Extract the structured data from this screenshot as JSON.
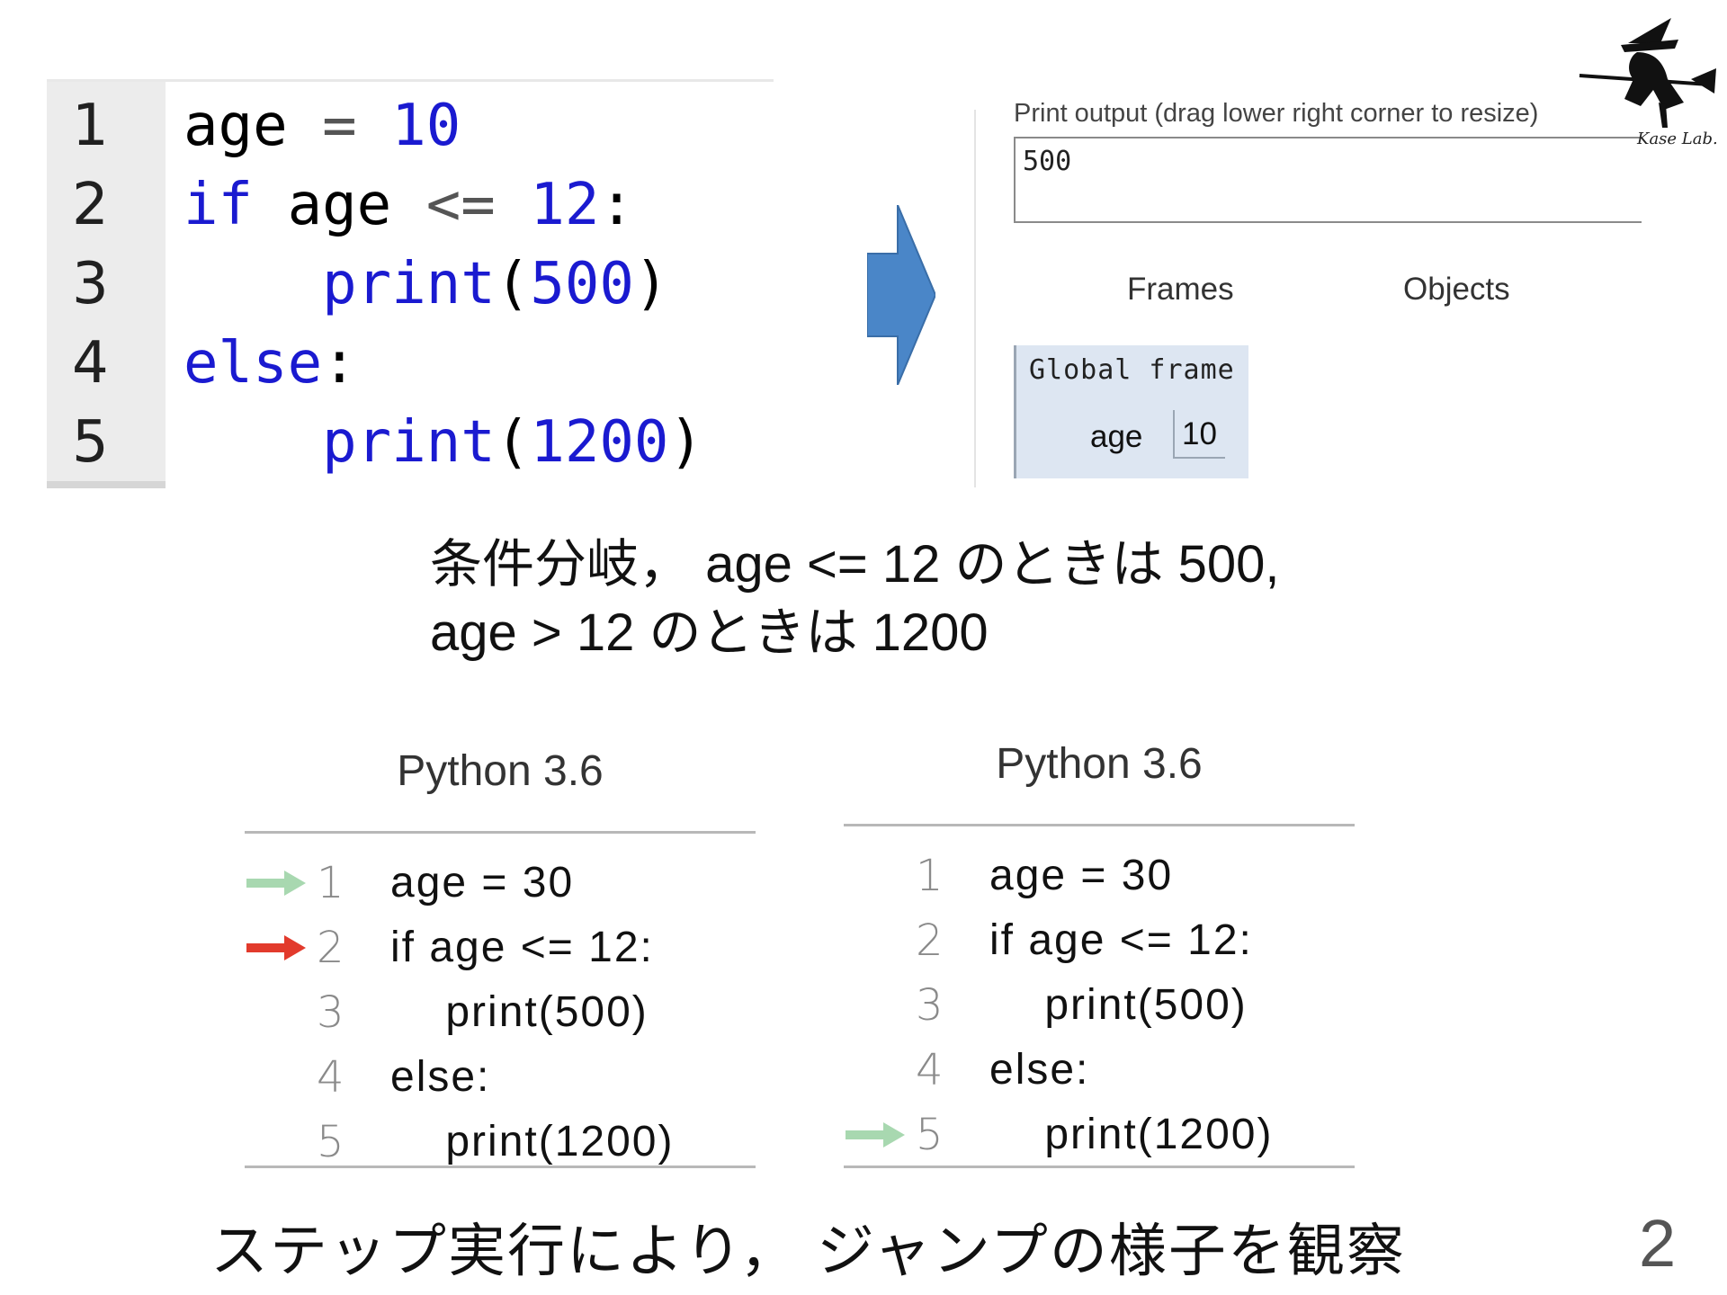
{
  "editor": {
    "lines": [
      {
        "num": "1",
        "tokens": [
          [
            "var",
            "age"
          ],
          [
            "op",
            " = "
          ],
          [
            "num",
            "10"
          ]
        ]
      },
      {
        "num": "2",
        "tokens": [
          [
            "kw",
            "if "
          ],
          [
            "var",
            "age "
          ],
          [
            "op",
            "<= "
          ],
          [
            "num",
            "12"
          ],
          [
            "var",
            ":"
          ]
        ]
      },
      {
        "num": "3",
        "tokens": [
          [
            "var",
            "    "
          ],
          [
            "kw",
            "print"
          ],
          [
            "var",
            "("
          ],
          [
            "num",
            "500"
          ],
          [
            "var",
            ")"
          ]
        ]
      },
      {
        "num": "4",
        "tokens": [
          [
            "kw",
            "else"
          ],
          [
            "var",
            ":"
          ]
        ]
      },
      {
        "num": "5",
        "tokens": [
          [
            "var",
            "    "
          ],
          [
            "kw",
            "print"
          ],
          [
            "var",
            "("
          ],
          [
            "num",
            "1200"
          ],
          [
            "var",
            ")"
          ]
        ]
      }
    ]
  },
  "arrow": {
    "icon": "right-arrow-icon",
    "color": "#4a86c8"
  },
  "output": {
    "label": "Print output (drag lower right corner to resize)",
    "value": "500"
  },
  "visualizer": {
    "frames_label": "Frames",
    "objects_label": "Objects",
    "global_frame_title": "Global frame",
    "var_name": "age",
    "var_value": "10"
  },
  "logo": {
    "text": "Kase Lab.",
    "icon": "witch-logo-icon"
  },
  "caption": {
    "line1": "条件分岐，  age <= 12 のときは 500,",
    "line2": "age > 12 のときは 1200"
  },
  "tutor_left": {
    "title": "Python 3.6",
    "lines": [
      {
        "num": "1",
        "code": "age = 30",
        "arrow": "prev"
      },
      {
        "num": "2",
        "code": "if age <= 12:",
        "arrow": "next"
      },
      {
        "num": "3",
        "code": "    print(500)",
        "arrow": ""
      },
      {
        "num": "4",
        "code": "else:",
        "arrow": ""
      },
      {
        "num": "5",
        "code": "    print(1200)",
        "arrow": ""
      }
    ]
  },
  "tutor_right": {
    "title": "Python 3.6",
    "lines": [
      {
        "num": "1",
        "code": "age = 30",
        "arrow": ""
      },
      {
        "num": "2",
        "code": "if age <= 12:",
        "arrow": ""
      },
      {
        "num": "3",
        "code": "    print(500)",
        "arrow": ""
      },
      {
        "num": "4",
        "code": "else:",
        "arrow": ""
      },
      {
        "num": "5",
        "code": "    print(1200)",
        "arrow": "prev"
      }
    ]
  },
  "colors": {
    "arrow_prev": "#a8d8b0",
    "arrow_next": "#e23a2c",
    "keyword": "#1a1ad0"
  },
  "bottom_caption": "ステップ実行により，  ジャンプの様子を観察",
  "page_number": "2"
}
